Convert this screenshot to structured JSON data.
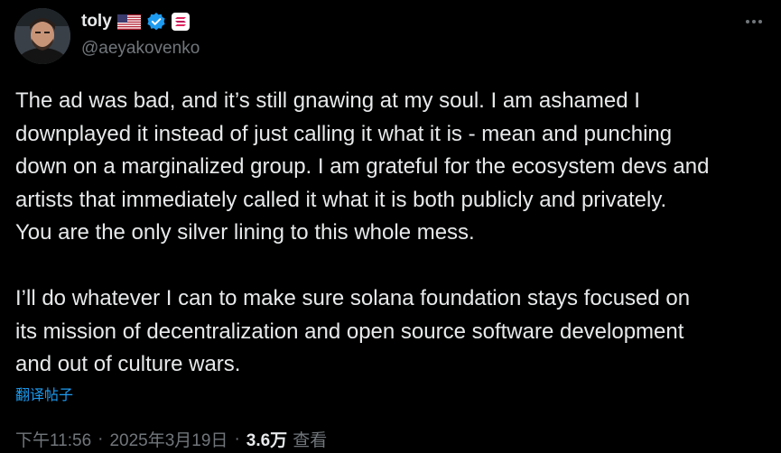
{
  "author": {
    "display_name": "toly",
    "handle": "@aeyakovenko",
    "flag_icon": "us-flag-icon",
    "verified_icon": "verified-badge-icon",
    "affiliate_icon": "solana-badge-icon"
  },
  "tweet": {
    "text": "The ad was bad, and it’s still gnawing at my soul. I am ashamed I\ndownplayed it instead of just calling it what it is - mean and punching\ndown on a marginalized group. I am grateful for the ecosystem devs and\nartists that immediately called it what it is both publicly and privately.\nYou are the only silver lining to this whole mess.\n\nI’ll do whatever I can to make sure solana foundation stays focused on\nits mission of decentralization and open source software development\nand out of culture wars.",
    "translate_label": "翻译帖子"
  },
  "meta": {
    "time": "下午11:56",
    "separator": "·",
    "date": "2025年3月19日",
    "views_count": "3.6万",
    "views_label": "查看"
  },
  "colors": {
    "background": "#000000",
    "text": "#e7e9ea",
    "secondary": "#71767b",
    "accent": "#1d9bf0"
  }
}
